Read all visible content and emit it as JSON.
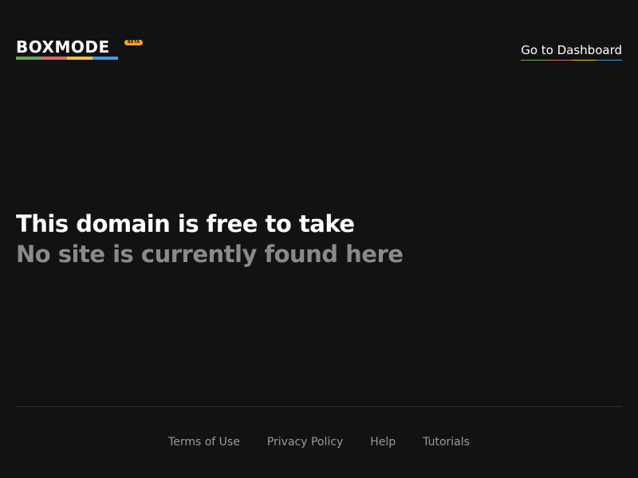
{
  "header": {
    "logo_text": "BOXMODE",
    "beta_label": "BETA",
    "logo_bar_colors": [
      "#6aa84f",
      "#e06666",
      "#f1c232",
      "#3d9be9"
    ],
    "dashboard_link_label": "Go to Dashboard",
    "dashboard_underline_colors": [
      "#6aa84f",
      "#e06666",
      "#f1c232",
      "#3d9be9"
    ]
  },
  "hero": {
    "title": "This domain is free to take",
    "subtitle": "No site is currently found here"
  },
  "footer": {
    "links": [
      {
        "label": "Terms of Use"
      },
      {
        "label": "Privacy Policy"
      },
      {
        "label": "Help"
      },
      {
        "label": "Tutorials"
      }
    ]
  },
  "colors": {
    "background": "#121212",
    "text_primary": "#ffffff",
    "text_muted": "#8a8a8a",
    "beta_badge": "#f5a623"
  }
}
